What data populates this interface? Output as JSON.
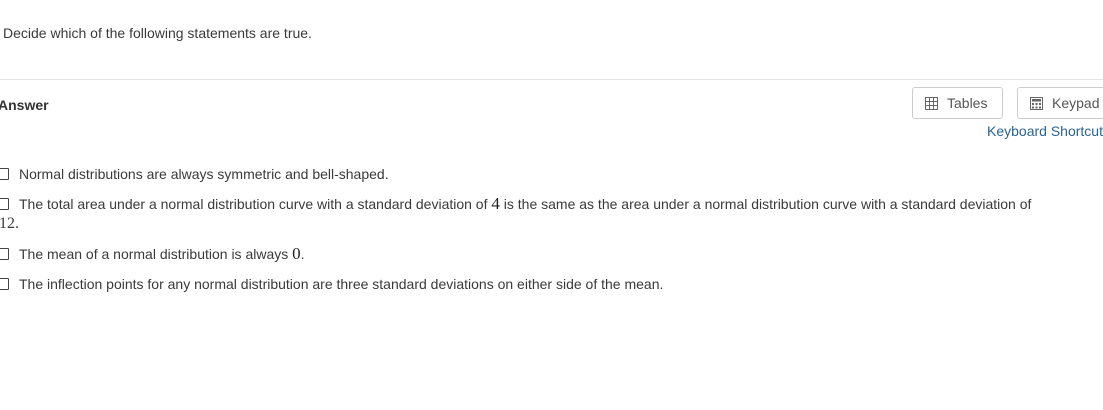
{
  "question": {
    "prompt": "Decide which of the following statements are true."
  },
  "answer": {
    "label": "Answer"
  },
  "toolbar": {
    "tables_label": "Tables",
    "tables_icon": "table-grid-icon",
    "keypad_label": "Keypad",
    "keypad_icon": "calculator-icon",
    "keyboard_shortcuts_label": "Keyboard Shortcuts"
  },
  "options": [
    {
      "text": "Normal distributions are always symmetric and bell-shaped.",
      "checked": false
    },
    {
      "text_before": "The total area under a normal distribution curve with a standard deviation of ",
      "math_1": "4",
      "text_middle": " is the same as the area under a normal distribution curve with a standard deviation of",
      "math_2": "12",
      "text_after": ".",
      "checked": false
    },
    {
      "text_before": "The mean of a normal distribution is always ",
      "math_1": "0",
      "text_after": ".",
      "checked": false
    },
    {
      "text": "The inflection points for any normal distribution are three standard deviations on either side of the mean.",
      "checked": false
    }
  ],
  "colors": {
    "link": "#2a6496",
    "divider": "#e3e3e3",
    "button_border": "#cccccc"
  }
}
